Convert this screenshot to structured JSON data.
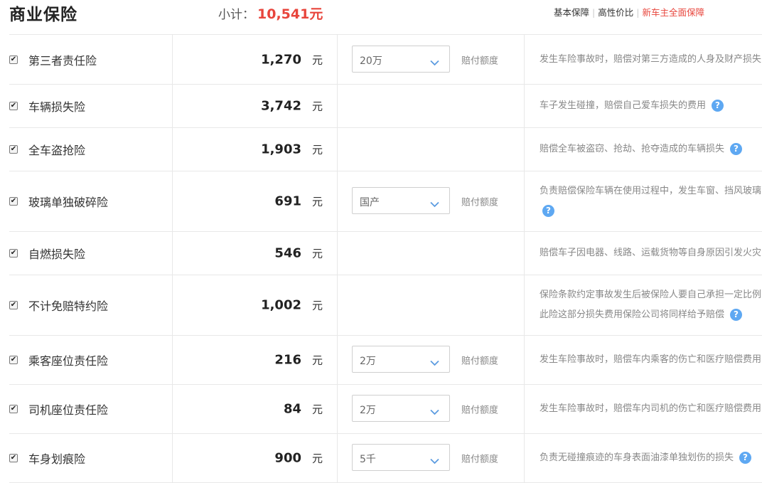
{
  "header": {
    "title": "商业保险",
    "subtotal_label": "小计：",
    "subtotal_value": "10,541元",
    "presets": [
      "基本保障",
      "高性价比",
      "新车主全面保障"
    ]
  },
  "colors": {
    "accent": "#e8453c",
    "help_icon": "#5ea8f2"
  },
  "rows": [
    {
      "checked": true,
      "name": "第三者责任险",
      "price": "1,270",
      "unit": "元",
      "option": "20万",
      "option_label": "赔付额度",
      "desc": [
        "发生车险事故时，赔偿对第三方造成的人身及财产损失"
      ],
      "help": false
    },
    {
      "checked": true,
      "name": "车辆损失险",
      "price": "3,742",
      "unit": "元",
      "option": null,
      "option_label": null,
      "desc": [
        "车子发生碰撞，赔偿自己爱车损失的费用"
      ],
      "help": true
    },
    {
      "checked": true,
      "name": "全车盗抢险",
      "price": "1,903",
      "unit": "元",
      "option": null,
      "option_label": null,
      "desc": [
        "赔偿全车被盗窃、抢劫、抢夺造成的车辆损失"
      ],
      "help": true
    },
    {
      "checked": true,
      "name": "玻璃单独破碎险",
      "price": "691",
      "unit": "元",
      "option": "国产",
      "option_label": "赔付额度",
      "desc": [
        "负责赔偿保险车辆在使用过程中，发生车窗、挡风玻璃",
        ""
      ],
      "help": true
    },
    {
      "checked": true,
      "name": "自燃损失险",
      "price": "546",
      "unit": "元",
      "option": null,
      "option_label": null,
      "desc": [
        "赔偿车子因电器、线路、运载货物等自身原因引发火灾"
      ],
      "help": false
    },
    {
      "checked": true,
      "name": "不计免赔特约险",
      "price": "1,002",
      "unit": "元",
      "option": null,
      "option_label": null,
      "desc": [
        "保险条款约定事故发生后被保险人要自己承担一定比例",
        "此险这部分损失费用保险公司将同样给予赔偿"
      ],
      "help": true
    },
    {
      "checked": true,
      "name": "乘客座位责任险",
      "price": "216",
      "unit": "元",
      "option": "2万",
      "option_label": "赔付额度",
      "desc": [
        "发生车险事故时，赔偿车内乘客的伤亡和医疗赔偿费用"
      ],
      "help": false
    },
    {
      "checked": true,
      "name": "司机座位责任险",
      "price": "84",
      "unit": "元",
      "option": "2万",
      "option_label": "赔付额度",
      "desc": [
        "发生车险事故时，赔偿车内司机的伤亡和医疗赔偿费用"
      ],
      "help": false
    },
    {
      "checked": true,
      "name": "车身划痕险",
      "price": "900",
      "unit": "元",
      "option": "5千",
      "option_label": "赔付额度",
      "desc": [
        "负责无碰撞痕迹的车身表面油漆单独划伤的损失"
      ],
      "help": true
    }
  ]
}
